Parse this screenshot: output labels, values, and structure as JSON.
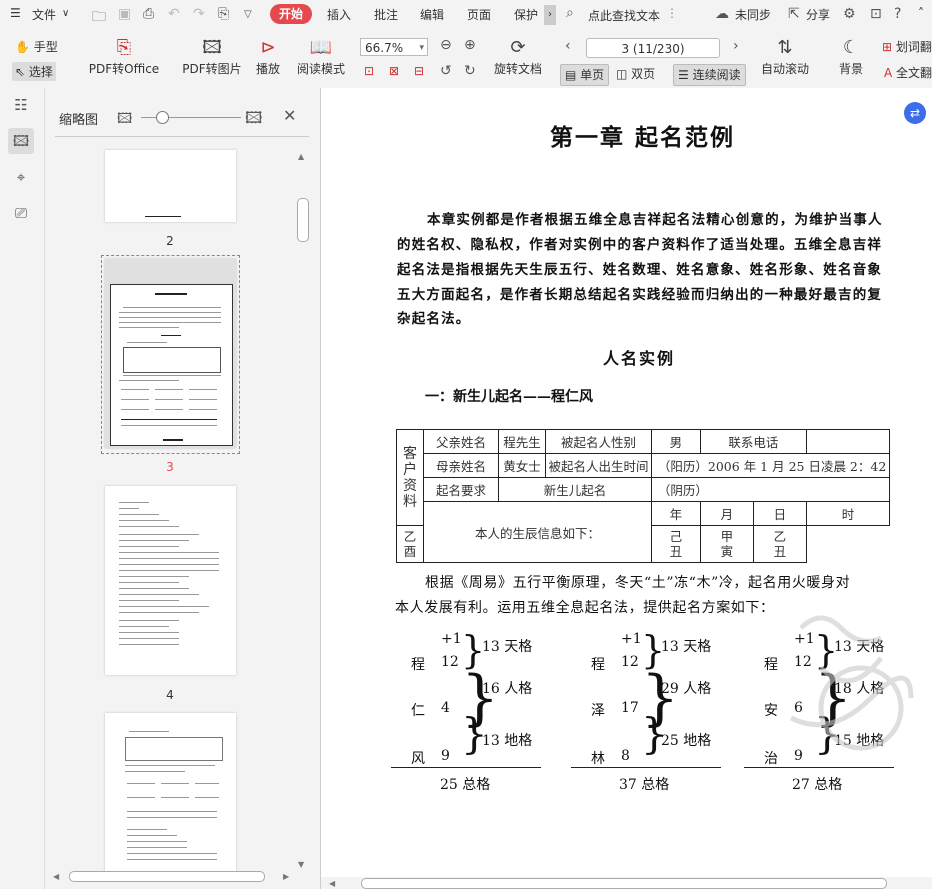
{
  "menu": {
    "file_label": "文件",
    "tabs": [
      "开始",
      "插入",
      "批注",
      "编辑",
      "页面",
      "保护"
    ],
    "search_label": "点此查找文本",
    "sync_label": "未同步",
    "share_label": "分享"
  },
  "ribbon": {
    "hand_tool": "手型",
    "select_tool": "选择",
    "pdf_to_office": "PDF转Office",
    "pdf_to_image": "PDF转图片",
    "play": "播放",
    "read_mode": "阅读模式",
    "zoom_value": "66.7%",
    "rotate_doc": "旋转文档",
    "page_field": "3 (11/230)",
    "single_page": "单页",
    "double_page": "双页",
    "continuous": "连续阅读",
    "auto_scroll": "自动滚动",
    "background": "背景",
    "word_translate": "划词翻",
    "full_translate": "全文翻"
  },
  "thumbnail_panel": {
    "title": "缩略图",
    "page_numbers": [
      "2",
      "3",
      "4"
    ]
  },
  "doc": {
    "chapter_title": "第一章  起名范例",
    "intro": [
      "本章实例都是作者根据五维全息吉祥起名法精心创意的，为维护当事人",
      "的姓名权、隐私权，作者对实例中的客户资料作了适当处理。五维全息吉祥",
      "起名法是指根据先天生辰五行、姓名数理、姓名意象、姓名形象、姓名音象",
      "五大方面起名，是作者长期总结起名实践经验而归纳出的一种最好最吉的复",
      "杂起名法。"
    ],
    "section_title": "人名实例",
    "subsection": "一：新生儿起名——程仁风",
    "table": {
      "side_label": "客户资料",
      "father_label": "父亲姓名",
      "father_value": "程先生",
      "gender_label": "被起名人性别",
      "gender_value": "男",
      "phone_label": "联系电话",
      "mother_label": "母亲姓名",
      "mother_value": "黄女士",
      "birth_label": "被起名人出生时间",
      "birth_value": "（阳历）2006 年 1 月 25 日凌晨 2：42",
      "request_label": "起名要求",
      "request_value": "新生儿起名",
      "lunar_label": "（阴历）",
      "bazi_label": "本人的生辰信息如下：",
      "bazi_headers": [
        "年",
        "月",
        "日",
        "时"
      ],
      "bazi_top": [
        "乙",
        "己",
        "甲",
        "乙"
      ],
      "bazi_bottom": [
        "酉",
        "丑",
        "寅",
        "丑"
      ]
    },
    "para2": [
      "根据《周易》五行平衡原理，冬天“土”冻“木”冷，起名用火暖身对",
      "本人发展有利。运用五维全息起名法，提供起名方案如下："
    ],
    "schemes": [
      {
        "plus": "+1",
        "chars": [
          "程",
          "仁",
          "风"
        ],
        "nums": [
          "12",
          "4",
          "9"
        ],
        "tian": "13 天格",
        "ren": "16 人格",
        "di": "13 地格",
        "total": "25 总格"
      },
      {
        "plus": "+1",
        "chars": [
          "程",
          "泽",
          "林"
        ],
        "nums": [
          "12",
          "17",
          "8"
        ],
        "tian": "13 天格",
        "ren": "29 人格",
        "di": "25 地格",
        "total": "37 总格"
      },
      {
        "plus": "+1",
        "chars": [
          "程",
          "安",
          "治"
        ],
        "nums": [
          "12",
          "6",
          "9"
        ],
        "tian": "13 天格",
        "ren": "18 人格",
        "di": "15 地格",
        "total": "27 总格"
      }
    ]
  }
}
